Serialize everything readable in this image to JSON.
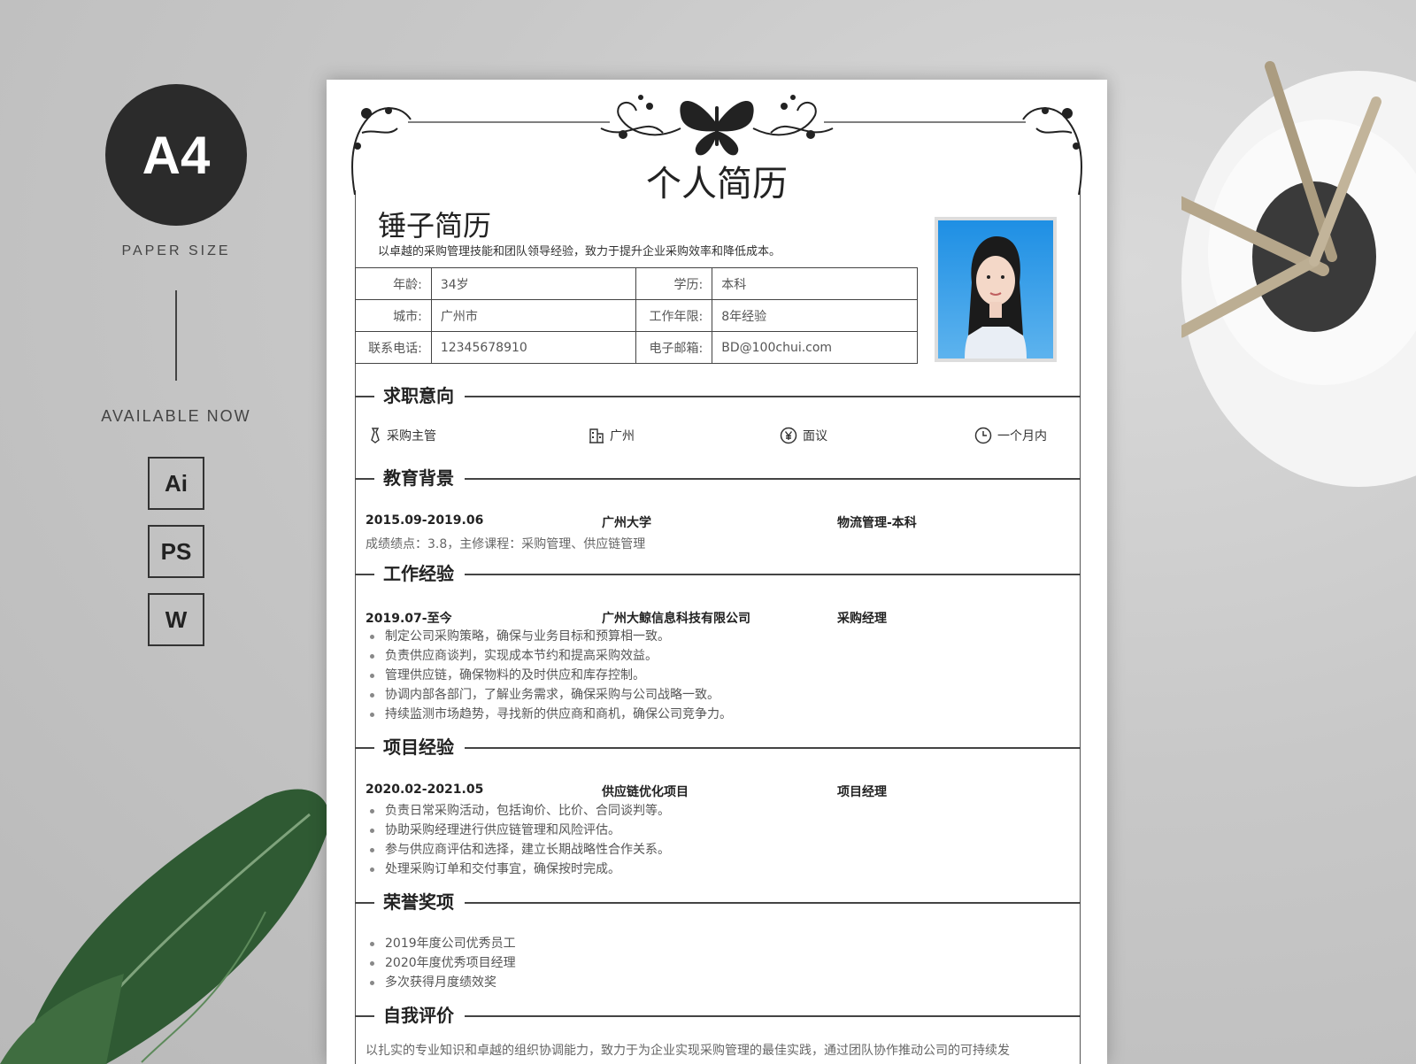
{
  "promo": {
    "size_label": "A4",
    "paper_size": "PAPER SIZE",
    "available": "AVAILABLE NOW",
    "formats": [
      "Ai",
      "PS",
      "W"
    ]
  },
  "resume": {
    "title": "个人简历",
    "name": "锤子简历",
    "slogan": "以卓越的采购管理技能和团队领导经验，致力于提升企业采购效率和降低成本。",
    "info": {
      "age_label": "年龄:",
      "age": "34岁",
      "edu_label": "学历:",
      "edu": "本科",
      "city_label": "城市:",
      "city": "广州市",
      "years_label": "工作年限:",
      "years": "8年经验",
      "phone_label": "联系电话:",
      "phone": "12345678910",
      "email_label": "电子邮箱:",
      "email": "BD@100chui.com"
    },
    "sections": {
      "intent": "求职意向",
      "education": "教育背景",
      "work": "工作经验",
      "project": "项目经验",
      "honors": "荣誉奖项",
      "self": "自我评价"
    },
    "intent": {
      "position": "采购主管",
      "city": "广州",
      "salary": "面议",
      "arrival": "一个月内"
    },
    "education": {
      "period": "2015.09-2019.06",
      "school": "广州大学",
      "major": "物流管理-本科",
      "detail": "成绩绩点：3.8，主修课程：采购管理、供应链管理"
    },
    "work": {
      "period": "2019.07-至今",
      "company": "广州大鲸信息科技有限公司",
      "role": "采购经理",
      "items": [
        "制定公司采购策略，确保与业务目标和预算相一致。",
        "负责供应商谈判，实现成本节约和提高采购效益。",
        "管理供应链，确保物料的及时供应和库存控制。",
        "协调内部各部门，了解业务需求，确保采购与公司战略一致。",
        "持续监测市场趋势，寻找新的供应商和商机，确保公司竞争力。"
      ]
    },
    "project": {
      "period": "2020.02-2021.05",
      "name": "供应链优化项目",
      "role": "项目经理",
      "items": [
        "负责日常采购活动，包括询价、比价、合同谈判等。",
        "协助采购经理进行供应链管理和风险评估。",
        "参与供应商评估和选择，建立长期战略性合作关系。",
        "处理采购订单和交付事宜，确保按时完成。"
      ]
    },
    "honors": [
      "2019年度公司优秀员工",
      "2020年度优秀项目经理",
      "多次获得月度绩效奖"
    ],
    "self_eval": "以扎实的专业知识和卓越的组织协调能力，致力于为企业实现采购管理的最佳实践，通过团队协作推动公司的可持续发"
  }
}
